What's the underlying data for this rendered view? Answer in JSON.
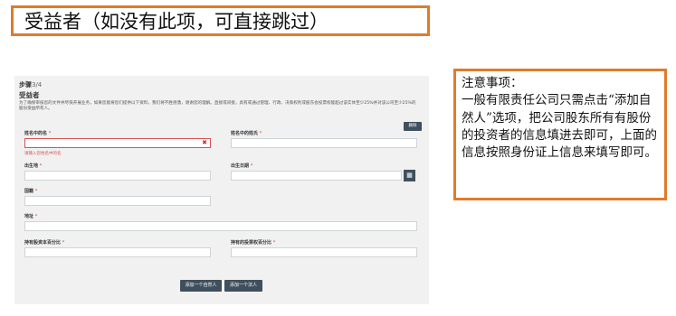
{
  "title_banner": "受益者（如没有此项，可直接跳过）",
  "note": {
    "title": "注意事项：",
    "body": "一般有限责任公司只需点击“添加自然人”选项，把公司股东所有有股份的投资者的信息填进去即可，上面的信息按照身份证上信息来填写即可。"
  },
  "form": {
    "step_label": "步骤",
    "step_fraction": "3/4",
    "section_title": "受益者",
    "description": "为了确保审核您的文件并尽快开展业务，如果您能将您们提供以下资料，我们将不胜感激，谢谢您的理解。直接或间接，具有或通过管理、行政、决策权利或股东会投票权能超过该实体至少25%并对该公司至少25%的股份受益所有人。",
    "delete_label": "删除",
    "required_mark": "*",
    "fields": {
      "given_name": {
        "label": "姓名中的名"
      },
      "middle_name": {
        "label": "姓名中的姓氏"
      },
      "birthplace": {
        "label": "出生地"
      },
      "birthdate": {
        "label": "出生日期"
      },
      "nationality": {
        "label": "国籍"
      },
      "address": {
        "label": "地址"
      },
      "capital_share": {
        "label": "持有股资本百分比"
      },
      "voting_share": {
        "label": "持有的投票权百分比"
      }
    },
    "given_name_error": "请输入您姓名中的名",
    "add_person_label": "添加一个自然人",
    "add_entity_label": "添加一个法人"
  },
  "icons": {
    "clear": "close-icon",
    "calendar": "calendar-icon"
  },
  "colors": {
    "banner_border": "#e07b2a",
    "button": "#3f4f5d",
    "error": "#d9534f"
  }
}
